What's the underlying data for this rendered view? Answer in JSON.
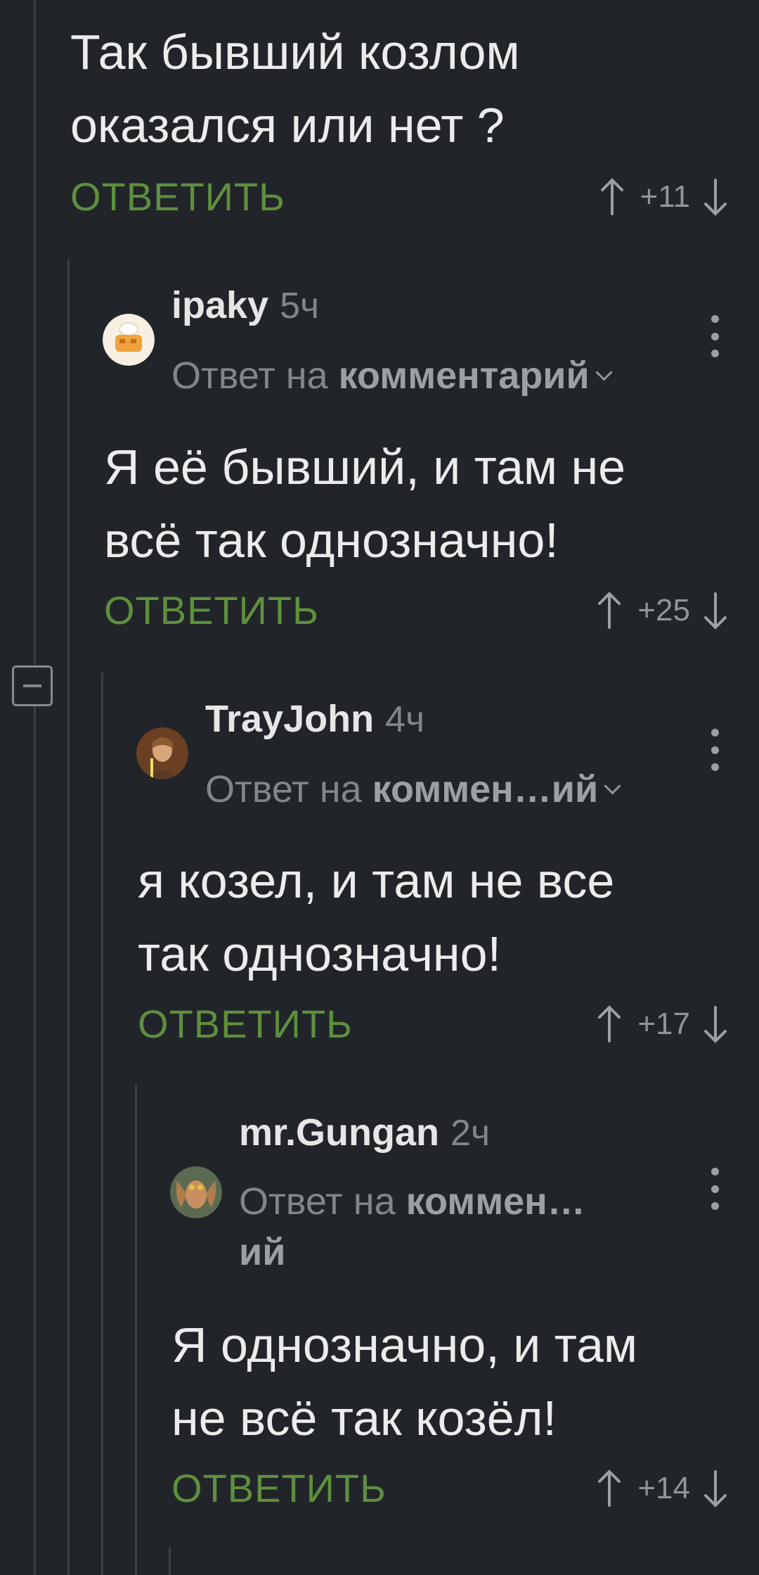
{
  "colors": {
    "background": "#212529",
    "accent_green": "#5e8f3e",
    "muted_text": "#80868c",
    "thread_line": "#3b4046"
  },
  "top_comment": {
    "text": "Так бывший козлом\nоказался или нет ?",
    "reply_label": "ОТВЕТИТЬ",
    "score": "+11"
  },
  "replies": [
    {
      "username": "ipaky",
      "time": "5ч",
      "reply_prefix": "Ответ на",
      "reply_target": "комментарий",
      "text": "Я её бывший, и там не\nвсё так однозначно!",
      "reply_label": "ОТВЕТИТЬ",
      "score": "+25",
      "avatar_icon": "chef-toaster-avatar"
    },
    {
      "username": "TrayJohn",
      "time": "4ч",
      "reply_prefix": "Ответ на",
      "reply_target": "коммен…ий",
      "text": "я козел, и там не все\nтак однозначно!",
      "reply_label": "ОТВЕТИТЬ",
      "score": "+17",
      "avatar_icon": "jedi-portrait-avatar"
    },
    {
      "username": "mr.Gungan",
      "time": "2ч",
      "reply_prefix": "Ответ на",
      "reply_target": "коммен…",
      "reply_target_cont": "ий",
      "text": "Я однозначно, и там\nне всё так козёл!",
      "reply_label": "ОТВЕТИТЬ",
      "score": "+14",
      "avatar_icon": "gungan-portrait-avatar"
    }
  ]
}
